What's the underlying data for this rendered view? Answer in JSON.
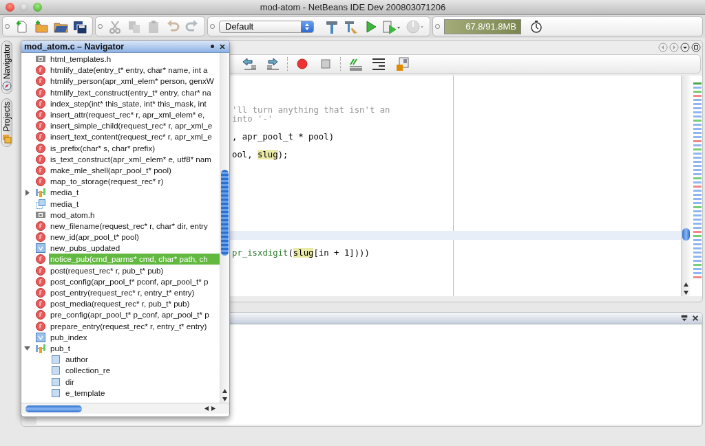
{
  "window": {
    "title": "mod-atom - NetBeans IDE Dev 200803071206"
  },
  "toolbar": {
    "groups": [
      {
        "buttons": [
          {
            "kind": "new-file",
            "disabled": false
          },
          {
            "kind": "new-project",
            "disabled": false
          },
          {
            "kind": "open-project",
            "disabled": false
          },
          {
            "kind": "save-all",
            "disabled": false
          }
        ]
      },
      {
        "buttons": [
          {
            "kind": "cut",
            "disabled": true
          },
          {
            "kind": "copy",
            "disabled": true
          },
          {
            "kind": "paste",
            "disabled": true
          },
          {
            "kind": "undo",
            "disabled": true
          },
          {
            "kind": "redo",
            "disabled": true
          }
        ]
      },
      {
        "config": {
          "value": "Default"
        },
        "buttons": [
          {
            "kind": "build",
            "disabled": false
          },
          {
            "kind": "clean-build",
            "disabled": false
          },
          {
            "kind": "run",
            "disabled": false
          },
          {
            "kind": "debug",
            "disabled": false
          },
          {
            "kind": "profile",
            "disabled": true
          }
        ]
      },
      {
        "memory": {
          "reading": "67.8/91.8MB"
        },
        "buttons": [
          {
            "kind": "gc",
            "disabled": false
          }
        ]
      }
    ]
  },
  "side_tabs": [
    {
      "label": "Navigator",
      "kind": "navigator"
    },
    {
      "label": "Projects",
      "kind": "projects"
    }
  ],
  "editor": {
    "toolbar": [
      {
        "kind": "shift-left"
      },
      {
        "kind": "shift-right"
      },
      {
        "kind": "record"
      },
      {
        "kind": "stop"
      },
      {
        "kind": "comment"
      },
      {
        "kind": "uncomment"
      },
      {
        "kind": "c-file"
      }
    ],
    "lines": [
      {
        "current": false
      },
      {
        "current": false
      },
      {
        "current": false
      },
      {
        "current": false,
        "segments": [
          {
            "kind": "comment",
            "text": "'ll turn anything that isn't an"
          }
        ]
      },
      {
        "current": false,
        "segments": [
          {
            "kind": "comment",
            "text": "into '-'"
          }
        ]
      },
      {
        "current": false
      },
      {
        "current": false,
        "segments": [
          {
            "kind": "plain",
            "text": ", apr_pool_t * pool)"
          }
        ]
      },
      {
        "current": false
      },
      {
        "current": false,
        "segments": [
          {
            "kind": "plain",
            "text": "ool, "
          },
          {
            "kind": "mark",
            "text": "slug"
          },
          {
            "kind": "plain",
            "text": ");"
          }
        ]
      },
      {
        "current": false
      },
      {
        "current": false
      },
      {
        "current": false
      },
      {
        "current": false
      },
      {
        "current": false
      },
      {
        "current": false
      },
      {
        "current": false
      },
      {
        "current": false
      },
      {
        "current": true
      },
      {
        "current": false
      },
      {
        "current": false,
        "segments": [
          {
            "kind": "method",
            "text": "pr_isxdigit"
          },
          {
            "kind": "plain",
            "text": "("
          },
          {
            "kind": "mark",
            "text": "slug"
          },
          {
            "kind": "plain",
            "text": "[in + 1])))"
          }
        ]
      }
    ]
  },
  "navigator": {
    "title": "mod_atom.c – Navigator",
    "items": [
      {
        "kind": "header",
        "label": "html_templates.h",
        "selected": false
      },
      {
        "kind": "function",
        "label": "htmlify_date(entry_t* entry, char* name, int a",
        "selected": false
      },
      {
        "kind": "function",
        "label": "htmlify_person(apr_xml_elem* person, genxW",
        "selected": false
      },
      {
        "kind": "function",
        "label": "htmlify_text_construct(entry_t* entry, char* na",
        "selected": false
      },
      {
        "kind": "function",
        "label": "index_step(int* this_state, int* this_mask, int",
        "selected": false
      },
      {
        "kind": "function",
        "label": "insert_attr(request_rec* r, apr_xml_elem* e,",
        "selected": false
      },
      {
        "kind": "function",
        "label": "insert_simple_child(request_rec* r, apr_xml_e",
        "selected": false
      },
      {
        "kind": "function",
        "label": "insert_text_content(request_rec* r, apr_xml_e",
        "selected": false
      },
      {
        "kind": "function",
        "label": "is_prefix(char* s, char* prefix)",
        "selected": false
      },
      {
        "kind": "function",
        "label": "is_text_construct(apr_xml_elem* e, utf8* nam",
        "selected": false
      },
      {
        "kind": "function",
        "label": "make_mle_shell(apr_pool_t* pool)",
        "selected": false
      },
      {
        "kind": "function",
        "label": "map_to_storage(request_rec* r)",
        "selected": false
      },
      {
        "kind": "struct",
        "label": "media_t",
        "selected": false,
        "expanded": false
      },
      {
        "kind": "typedef",
        "label": "media_t",
        "selected": false
      },
      {
        "kind": "header",
        "label": "mod_atom.h",
        "selected": false
      },
      {
        "kind": "function",
        "label": "new_filename(request_rec* r, char* dir, entry",
        "selected": false
      },
      {
        "kind": "function",
        "label": "new_id(apr_pool_t* pool)",
        "selected": false
      },
      {
        "kind": "variable",
        "label": "new_pubs_updated",
        "selected": false
      },
      {
        "kind": "function",
        "label": "notice_pub(cmd_parms* cmd, char* path, ch",
        "selected": true
      },
      {
        "kind": "function",
        "label": "post(request_rec* r, pub_t* pub)",
        "selected": false
      },
      {
        "kind": "function",
        "label": "post_config(apr_pool_t* pconf, apr_pool_t* p",
        "selected": false
      },
      {
        "kind": "function",
        "label": "post_entry(request_rec* r, entry_t* entry)",
        "selected": false
      },
      {
        "kind": "function",
        "label": "post_media(request_rec* r, pub_t* pub)",
        "selected": false
      },
      {
        "kind": "function",
        "label": "pre_config(apr_pool_t* p_conf, apr_pool_t* p",
        "selected": false
      },
      {
        "kind": "function",
        "label": "prepare_entry(request_rec* r, entry_t* entry)",
        "selected": false
      },
      {
        "kind": "variable",
        "label": "pub_index",
        "selected": false
      },
      {
        "kind": "struct",
        "label": "pub_t",
        "selected": false,
        "expanded": true,
        "children": [
          {
            "kind": "field",
            "label": "author",
            "selected": false
          },
          {
            "kind": "field",
            "label": "collection_re",
            "selected": false
          },
          {
            "kind": "field",
            "label": "dir",
            "selected": false
          },
          {
            "kind": "field",
            "label": "e_template",
            "selected": false
          }
        ]
      }
    ]
  }
}
